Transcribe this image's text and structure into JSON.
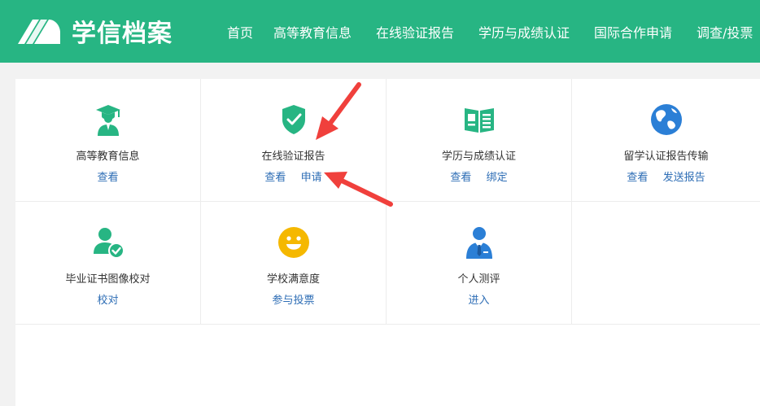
{
  "header": {
    "brand": "学信档案",
    "nav": [
      "首页",
      "高等教育信息",
      "在线验证报告",
      "学历与成绩认证",
      "国际合作申请",
      "调查/投票"
    ]
  },
  "colors": {
    "brand_green": "#27b583",
    "link_blue": "#2d6db5",
    "annotation_red": "#f0403c"
  },
  "grid": [
    {
      "title": "高等教育信息",
      "icon": "graduate-icon",
      "links": [
        "查看"
      ]
    },
    {
      "title": "在线验证报告",
      "icon": "shield-check-icon",
      "links": [
        "查看",
        "申请"
      ]
    },
    {
      "title": "学历与成绩认证",
      "icon": "certificate-book-icon",
      "links": [
        "查看",
        "绑定"
      ]
    },
    {
      "title": "留学认证报告传输",
      "icon": "globe-icon",
      "links": [
        "查看",
        "发送报告"
      ]
    },
    {
      "title": "毕业证书图像校对",
      "icon": "user-check-icon",
      "links": [
        "校对"
      ]
    },
    {
      "title": "学校满意度",
      "icon": "smiley-icon",
      "links": [
        "参与投票"
      ]
    },
    {
      "title": "个人测评",
      "icon": "business-person-icon",
      "links": [
        "进入"
      ]
    }
  ]
}
